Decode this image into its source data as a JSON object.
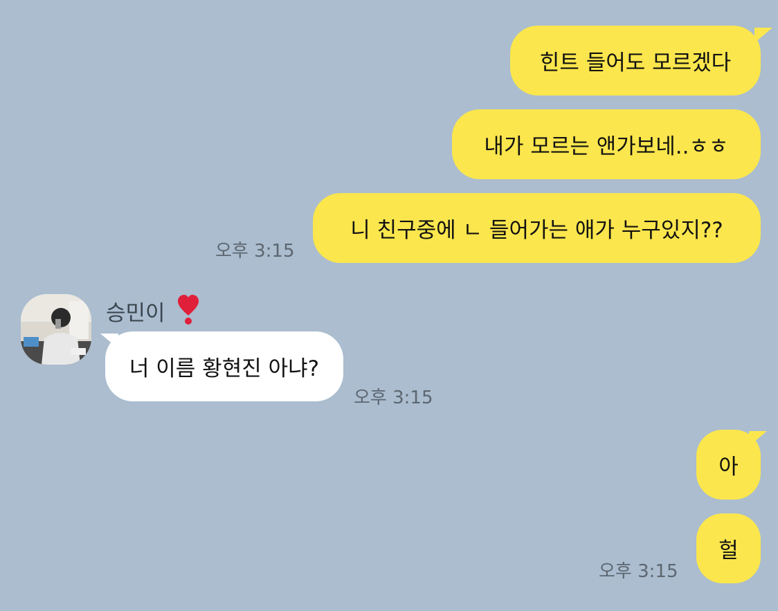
{
  "chat": {
    "messages": [
      {
        "sender": "me",
        "text": "힌트 들어도 모르겠다"
      },
      {
        "sender": "me",
        "text": "내가 모르는 앤가보네..ㅎㅎ"
      },
      {
        "sender": "me",
        "text": "니 친구중에 ㄴ 들어가는 애가 누구있지??",
        "time": "오후 3:15"
      },
      {
        "sender": "other",
        "name": "승민이",
        "name_emoji": "heavy-heart-exclamation-icon",
        "text": "너 이름 황현진 아냐?",
        "time": "오후 3:15"
      },
      {
        "sender": "me",
        "text": "아"
      },
      {
        "sender": "me",
        "text": "헐",
        "time": "오후 3:15"
      }
    ]
  },
  "colors": {
    "background": "#abbdcf",
    "my_bubble": "#fbe64d",
    "their_bubble": "#ffffff",
    "timestamp": "#5d6670"
  }
}
